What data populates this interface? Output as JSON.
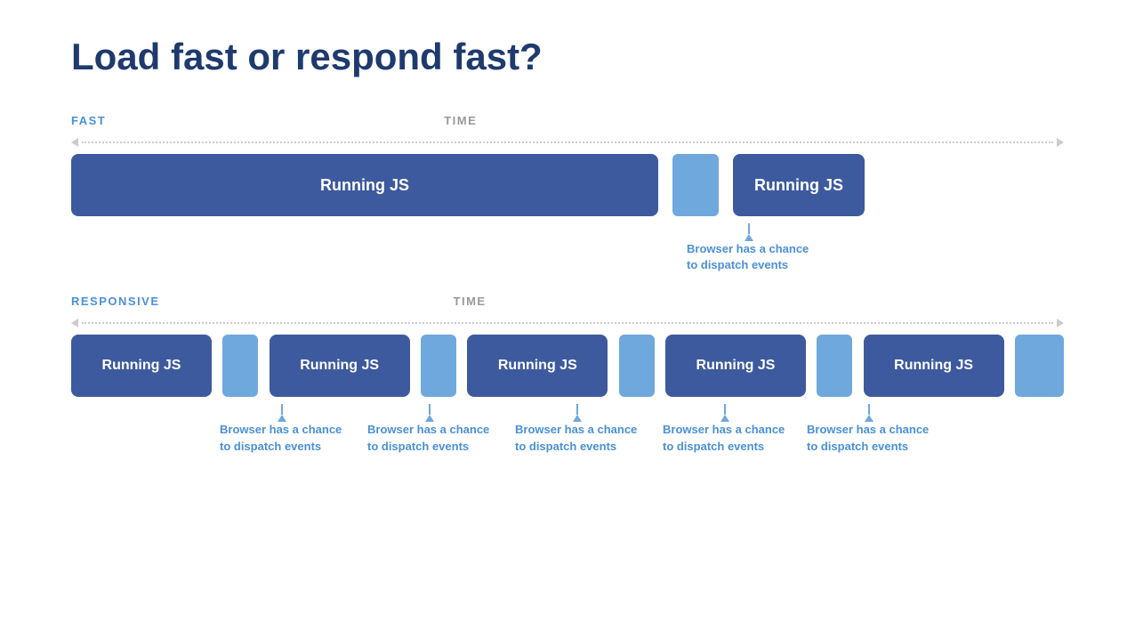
{
  "title": "Load fast or respond fast?",
  "fast_section": {
    "label_fast": "FAST",
    "label_time": "TIME",
    "js_block_label": "Running JS",
    "js_block2_label": "Running JS",
    "annotation": "Browser has a chance to dispatch events"
  },
  "responsive_section": {
    "label_responsive": "RESPONSIVE",
    "label_time": "TIME",
    "js_labels": [
      "Running JS",
      "Running JS",
      "Running JS",
      "Running JS",
      "Running JS"
    ],
    "annotation": "Browser has a chance to dispatch events"
  }
}
